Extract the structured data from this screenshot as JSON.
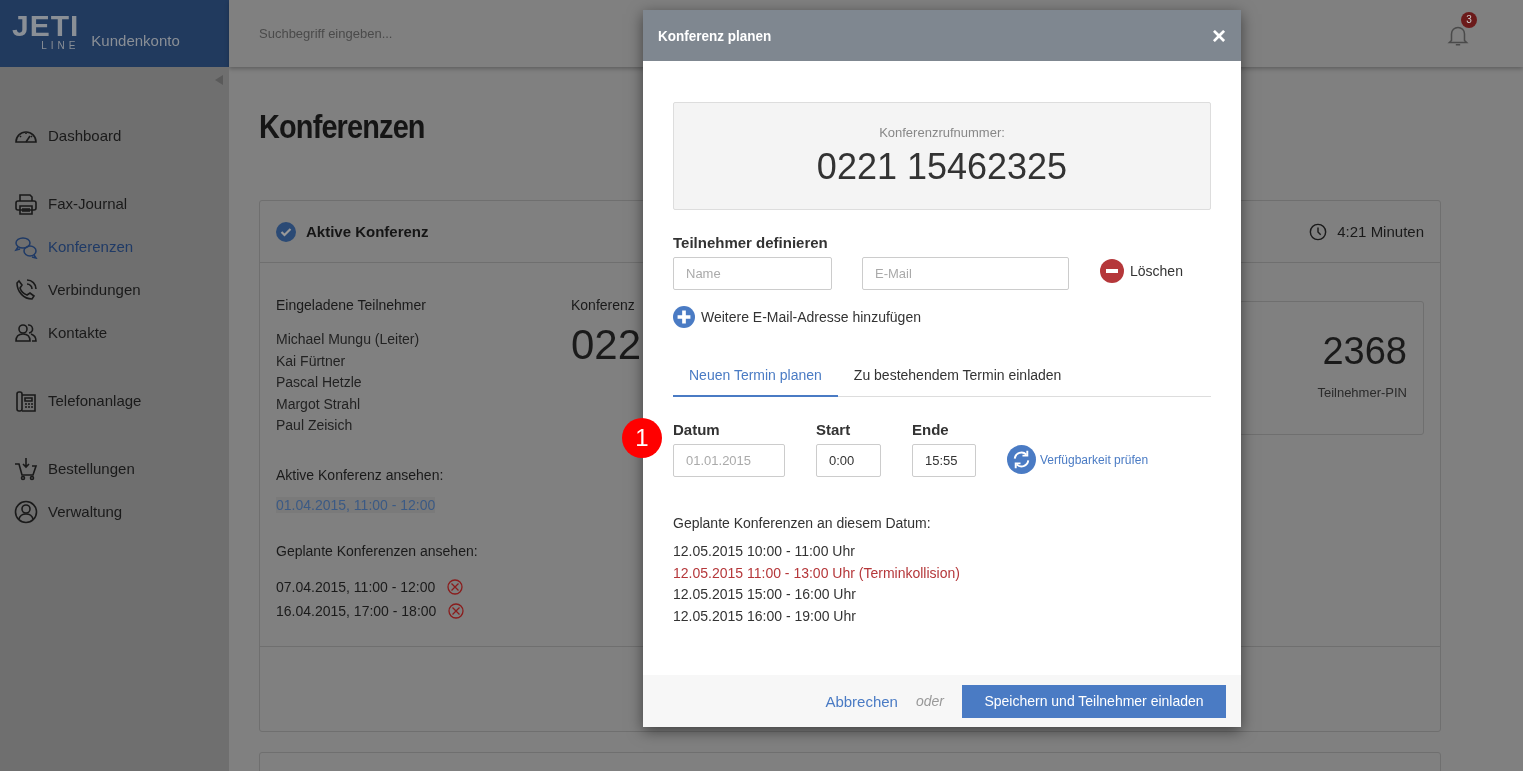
{
  "header": {
    "logo_top": "JETI",
    "logo_bottom": "LINE",
    "account": "Kundenkonto",
    "search_placeholder": "Suchbegriff eingeben...",
    "notification_count": "3"
  },
  "sidebar": {
    "groups": [
      [
        {
          "label": "Dashboard",
          "selected": false
        }
      ],
      [
        {
          "label": "Fax-Journal",
          "selected": false
        },
        {
          "label": "Konferenzen",
          "selected": true
        },
        {
          "label": "Verbindungen",
          "selected": false
        },
        {
          "label": "Kontakte",
          "selected": false
        }
      ],
      [
        {
          "label": "Telefonanlage",
          "selected": false
        }
      ],
      [
        {
          "label": "Bestellungen",
          "selected": false
        },
        {
          "label": "Verwaltung",
          "selected": false
        }
      ]
    ]
  },
  "page_title": "Konferenzen",
  "active_conference": {
    "title": "Aktive Konferenz",
    "duration": "4:21 Minuten",
    "participants_heading": "Eingeladene Teilnehmer",
    "participants": [
      "Michael Mungu (Leiter)",
      "Kai Fürtner",
      "Pascal Hetzle",
      "Margot Strahl",
      "Paul Zeisich"
    ],
    "view_active_heading": "Aktive Konferenz ansehen:",
    "active_link": "01.04.2015, 11:00 - 12:00",
    "view_planned_heading": "Geplante Konferenzen ansehen:",
    "planned": [
      "07.04.2015, 11:00 - 12:00",
      "16.04.2015, 17:00 - 18:00"
    ],
    "number_label": "Konferenz",
    "number": "022",
    "pin": "2368",
    "pin_label": "Teilnehmer-PIN"
  },
  "modal": {
    "title": "Konferenz planen",
    "close": "×",
    "number_label": "Konferenzrufnummer:",
    "number": "0221 15462325",
    "participants_heading": "Teilnehmer definieren",
    "name_placeholder": "Name",
    "email_placeholder": "E-Mail",
    "delete": "Löschen",
    "add_email": "Weitere E-Mail-Adresse hinzufügen",
    "tabs": [
      {
        "label": "Neuen Termin planen",
        "selected": true
      },
      {
        "label": "Zu bestehendem Termin einladen",
        "selected": false
      }
    ],
    "fields": [
      {
        "label": "Datum",
        "placeholder": "01.01.2015"
      },
      {
        "label": "Start",
        "value": "0:00"
      },
      {
        "label": "Ende",
        "value": "15:55"
      }
    ],
    "check_availability": "Verfügbarkeit prüfen",
    "scheduled_heading": "Geplante Konferenzen an diesem Datum:",
    "scheduled": [
      {
        "text": "12.05.2015 10:00 - 11:00 Uhr",
        "conflict": false
      },
      {
        "text": "12.05.2015 11:00 - 13:00 Uhr (Terminkollision)",
        "conflict": true
      },
      {
        "text": "12.05.2015 15:00 - 16:00 Uhr",
        "conflict": false
      },
      {
        "text": "12.05.2015 16:00 - 19:00 Uhr",
        "conflict": false
      }
    ],
    "cancel": "Abbrechen",
    "or": "oder",
    "submit": "Speichern und Teilnehmer einladen"
  },
  "callout_marker": "1"
}
